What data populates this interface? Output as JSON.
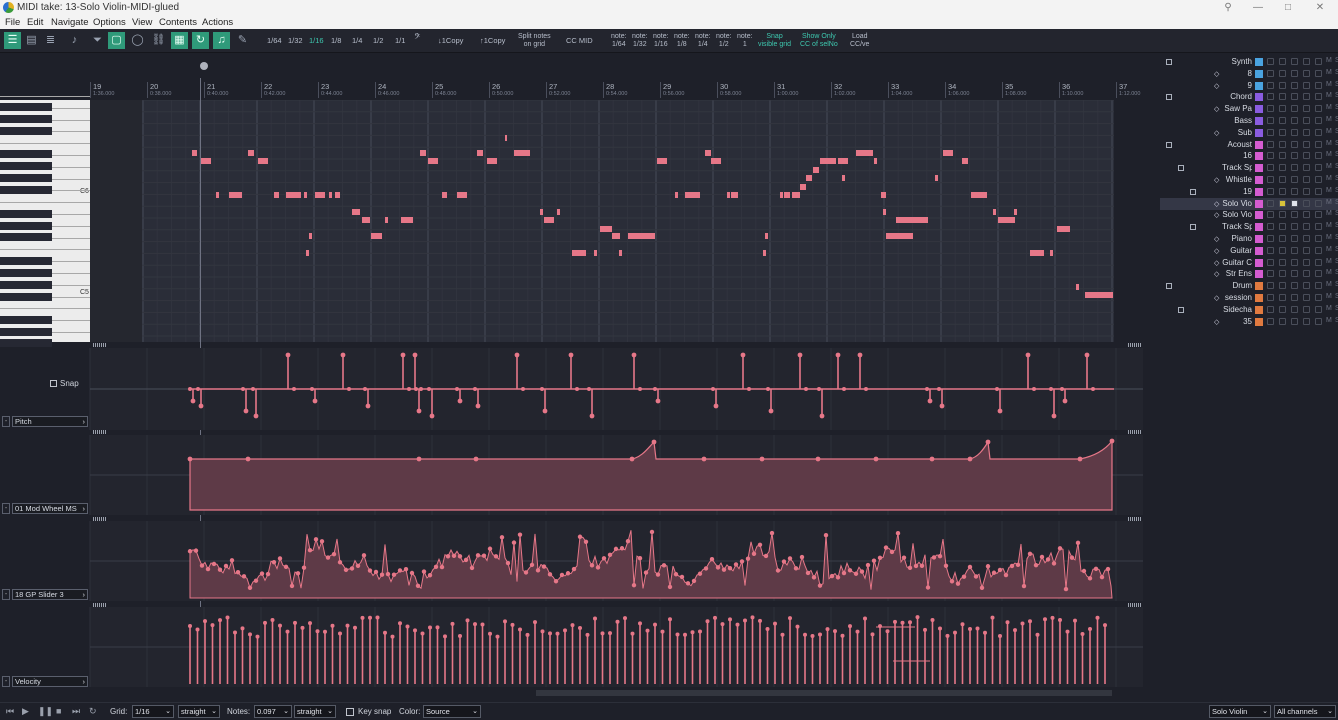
{
  "window": {
    "title": "MIDI take: 13-Solo Violin-MIDI-glued"
  },
  "menu": [
    "File",
    "Edit",
    "Navigate",
    "Options",
    "View",
    "Contents",
    "Actions"
  ],
  "toolbar": {
    "grid_values": [
      "1/64",
      "1/32",
      "1/16",
      "1/8",
      "1/4",
      "1/2",
      "1/1"
    ],
    "active_grid": "1/16",
    "copy_down": "↓1Copy",
    "copy_up": "↑1Copy",
    "split_notes": "Split notes\non grid",
    "cc_mid": "CC MID",
    "note_lengths": [
      {
        "top": "note:",
        "bottom": "1/64"
      },
      {
        "top": "note:",
        "bottom": "1/32"
      },
      {
        "top": "note:",
        "bottom": "1/16"
      },
      {
        "top": "note:",
        "bottom": "1/8"
      },
      {
        "top": "note:",
        "bottom": "1/4"
      },
      {
        "top": "note:",
        "bottom": "1/2"
      },
      {
        "top": "note:",
        "bottom": "1"
      }
    ],
    "snap_visible": "Snap\nvisible grid",
    "show_only_cc": "Show Only\nCC of selNo",
    "load_cc": "Load\nCC/ve"
  },
  "ruler": [
    {
      "bar": "19",
      "time": "1:36.000"
    },
    {
      "bar": "20",
      "time": "0:38.000"
    },
    {
      "bar": "21",
      "time": "0:40.000"
    },
    {
      "bar": "22",
      "time": "0:42.000"
    },
    {
      "bar": "23",
      "time": "0:44.000"
    },
    {
      "bar": "24",
      "time": "0:46.000"
    },
    {
      "bar": "25",
      "time": "0:48.000"
    },
    {
      "bar": "26",
      "time": "0:50.000"
    },
    {
      "bar": "27",
      "time": "0:52.000"
    },
    {
      "bar": "28",
      "time": "0:54.000"
    },
    {
      "bar": "29",
      "time": "0:56.000"
    },
    {
      "bar": "30",
      "time": "0:58.000"
    },
    {
      "bar": "31",
      "time": "1:00.000"
    },
    {
      "bar": "32",
      "time": "1:02.000"
    },
    {
      "bar": "33",
      "time": "1:04.000"
    },
    {
      "bar": "34",
      "time": "1:06.000"
    },
    {
      "bar": "35",
      "time": "1:08.000"
    },
    {
      "bar": "36",
      "time": "1:10.000"
    },
    {
      "bar": "37",
      "time": "1:12.000"
    }
  ],
  "piano": {
    "c6": "C6",
    "c5": "C5"
  },
  "lanes": {
    "snap": "Snap",
    "pitch": "Pitch",
    "mod": "01 Mod Wheel MS",
    "gp": "18 GP Slider 3",
    "velocity": "Velocity"
  },
  "tracks": [
    {
      "name": "Synth",
      "color": "#4aa3e0"
    },
    {
      "name": "8",
      "color": "#4aa3e0"
    },
    {
      "name": "9",
      "color": "#4aa3e0"
    },
    {
      "name": "Chord",
      "color": "#8a5ce0"
    },
    {
      "name": "Saw Pa",
      "color": "#8a5ce0"
    },
    {
      "name": "Bass",
      "color": "#8a5ce0"
    },
    {
      "name": "Sub",
      "color": "#8a5ce0"
    },
    {
      "name": "Acoust",
      "color": "#d45cd0"
    },
    {
      "name": "16",
      "color": "#d45cd0"
    },
    {
      "name": "Track Sp",
      "color": "#d45cd0"
    },
    {
      "name": "Whistle",
      "color": "#d45cd0"
    },
    {
      "name": "19",
      "color": "#d45cd0"
    },
    {
      "name": "Solo Vio",
      "color": "#d45cd0"
    },
    {
      "name": "Solo Vio",
      "color": "#d45cd0"
    },
    {
      "name": "Track Sp",
      "color": "#d45cd0"
    },
    {
      "name": "Piano",
      "color": "#d45cd0"
    },
    {
      "name": "Guitar",
      "color": "#d45cd0"
    },
    {
      "name": "Guitar C",
      "color": "#d45cd0"
    },
    {
      "name": "Str Ens",
      "color": "#d45cd0"
    },
    {
      "name": "Drum",
      "color": "#e07a40"
    },
    {
      "name": "session",
      "color": "#e07a40"
    },
    {
      "name": "Sidecha",
      "color": "#e07a40"
    },
    {
      "name": "35",
      "color": "#e07a40"
    }
  ],
  "status": {
    "grid_label": "Grid:",
    "grid_value": "1/16",
    "grid_type": "straight",
    "notes_label": "Notes:",
    "notes_value": "0.097",
    "notes_type": "straight",
    "key_snap": "Key snap",
    "color_label": "Color:",
    "color_value": "Source",
    "track_select": "Solo Violin",
    "channel_select": "All channels"
  },
  "colors": {
    "note": "#e67788",
    "accent": "#2f9a7a",
    "teal_text": "#3ec9b0"
  }
}
